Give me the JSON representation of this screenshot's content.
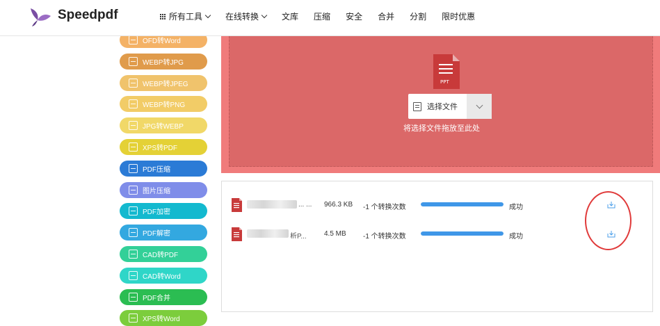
{
  "header": {
    "brand": "Speedpdf",
    "nav": [
      "所有工具",
      "在线转换",
      "文库",
      "压缩",
      "安全",
      "合并",
      "分割",
      "限时优惠"
    ]
  },
  "sidebar": {
    "items": [
      {
        "label": "OFD转Word",
        "color": "#f4b266"
      },
      {
        "label": "WEBP转JPG",
        "color": "#e09b4b"
      },
      {
        "label": "WEBP转JPEG",
        "color": "#f0c36c"
      },
      {
        "label": "WEBP转PNG",
        "color": "#f2cc67"
      },
      {
        "label": "JPG转WEBP",
        "color": "#f1d868"
      },
      {
        "label": "XPS转PDF",
        "color": "#e4d136"
      },
      {
        "label": "PDF压缩",
        "color": "#2b7bd6"
      },
      {
        "label": "图片压缩",
        "color": "#7f8de9"
      },
      {
        "label": "PDF加密",
        "color": "#13b9cf"
      },
      {
        "label": "PDF解密",
        "color": "#33a8e0"
      },
      {
        "label": "CAD转PDF",
        "color": "#33d098"
      },
      {
        "label": "CAD转Word",
        "color": "#2fd6c8"
      },
      {
        "label": "PDF合并",
        "color": "#2bbd52"
      },
      {
        "label": "XPS转Word",
        "color": "#7ccd3c"
      }
    ]
  },
  "upload": {
    "select_label": "选择文件",
    "drop_hint": "将选择文件拖放至此处",
    "file_badge": "PPT"
  },
  "files": [
    {
      "name": "... ...",
      "size": "966.3 KB",
      "count": "-1 个转换次数",
      "progress": 1.0,
      "status": "成功"
    },
    {
      "name": "析P...",
      "size": "4.5 MB",
      "count": "-1 个转换次数",
      "progress": 1.0,
      "status": "成功"
    }
  ],
  "colors": {
    "dropzone_outer": "#f07b7b",
    "dropzone_inner": "#db6868",
    "progress": "#3f97e8",
    "annotation_circle": "#e03a3a",
    "download_icon": "#4a9ee8"
  }
}
